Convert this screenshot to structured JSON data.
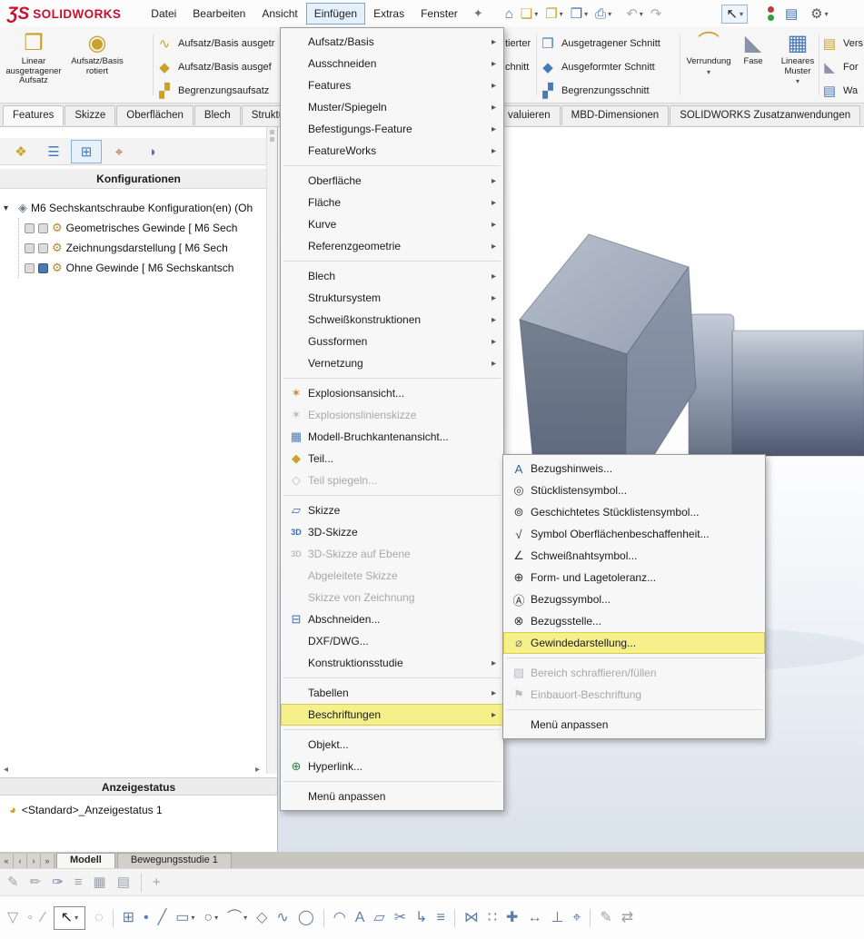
{
  "glyphs": {
    "submenu_arrow": "▸",
    "expander": "▾",
    "root_icon": "◈",
    "config_icon": "⚙",
    "display_state_icon": "◕",
    "scroll_left": "◂",
    "scroll_right": "▸",
    "caret": "▾",
    "cursor": "↖"
  },
  "colors": {
    "brand_red": "#c8102e",
    "highlight_yellow": "#f6f08b",
    "menu_open_blue": "#e4f0fb"
  },
  "menubar": {
    "logo_mark": "ƷS",
    "logo_text": "SOLIDWORKS",
    "pin_glyph": "✦",
    "menus": [
      {
        "label": "Datei"
      },
      {
        "label": "Bearbeiten"
      },
      {
        "label": "Ansicht"
      },
      {
        "label": "Einfügen",
        "open": true
      },
      {
        "label": "Extras"
      },
      {
        "label": "Fenster"
      }
    ],
    "quick_icons": [
      {
        "name": "ds-home-icon",
        "glyph": "⌂",
        "color": "#3b6fb5",
        "gap": 6
      },
      {
        "name": "new-document-icon",
        "glyph": "❏",
        "color": "#c9a227",
        "caret": true
      },
      {
        "name": "open-document-icon",
        "glyph": "❐",
        "color": "#c9a227",
        "caret": true
      },
      {
        "name": "save-icon",
        "glyph": "❒",
        "color": "#3b6fb5",
        "caret": true
      },
      {
        "name": "print-icon",
        "glyph": "⎙",
        "color": "#3b6fb5",
        "caret": true
      },
      {
        "name": "undo-icon",
        "glyph": "↶",
        "color": "#a8adb3",
        "caret": true,
        "gap": 8
      },
      {
        "name": "redo-icon",
        "glyph": "↷",
        "color": "#a8adb3"
      },
      {
        "name": "select-cursor-icon",
        "glyph": "↖",
        "color": "#222222",
        "caret": true,
        "boxed": true,
        "gap": 62
      },
      {
        "name": "status-indicator-icon",
        "dual": [
          "#c23b3b",
          "#2f9e44"
        ],
        "gap": 18
      },
      {
        "name": "task-pane-icon",
        "glyph": "▤",
        "color": "#3b6fb5",
        "gap": 4
      },
      {
        "name": "options-gear-icon",
        "glyph": "⚙",
        "color": "#5a5a5a",
        "caret": true,
        "gap": 6
      }
    ]
  },
  "features_toolbar": {
    "large_left": [
      {
        "label": "Linear\nausgetragener\nAufsatz",
        "icon": {
          "name": "extruded-boss-icon",
          "glyph": "❒",
          "color": "#c9a227"
        }
      },
      {
        "label": "Aufsatz/Basis\nrotiert",
        "icon": {
          "name": "revolved-boss-icon",
          "glyph": "◉",
          "color": "#c9a227"
        }
      }
    ],
    "small_left": [
      {
        "label": "Aufsatz/Basis ausgetr",
        "icon": {
          "name": "swept-boss-icon",
          "glyph": "∿",
          "color": "#c9a227"
        }
      },
      {
        "label": "Aufsatz/Basis ausgef",
        "icon": {
          "name": "lofted-boss-icon",
          "glyph": "◆",
          "color": "#c9a227"
        }
      },
      {
        "label": "Begrenzungsaufsatz",
        "icon": {
          "name": "boundary-boss-icon",
          "glyph": "▞",
          "color": "#c9a227"
        }
      }
    ],
    "hidden_fragments": [
      "tierter",
      "chnitt"
    ],
    "small_right": [
      {
        "label": "Ausgetragener Schnitt",
        "icon": {
          "name": "swept-cut-icon",
          "glyph": "❒",
          "color": "#4a7ab5"
        }
      },
      {
        "label": "Ausgeformter Schnitt",
        "icon": {
          "name": "lofted-cut-icon",
          "glyph": "◆",
          "color": "#4a7ab5"
        }
      },
      {
        "label": "Begrenzungsschnitt",
        "icon": {
          "name": "boundary-cut-icon",
          "glyph": "▞",
          "color": "#4a7ab5"
        }
      }
    ],
    "large_right": [
      {
        "label": "Verrundung",
        "caret": true,
        "icon": {
          "name": "fillet-icon",
          "glyph": "⌒",
          "color": "#c9a227"
        }
      },
      {
        "label": "Fase",
        "narrow": true,
        "icon": {
          "name": "chamfer-icon",
          "glyph": "◣",
          "color": "#8a93a5"
        }
      },
      {
        "label": "Lineares\nMuster",
        "caret": true,
        "icon": {
          "name": "linear-pattern-icon",
          "glyph": "▦",
          "color": "#4a7ab5"
        }
      }
    ],
    "edge_fragments": [
      {
        "label": "Vers",
        "icon": {
          "name": "rib-icon",
          "glyph": "▤",
          "color": "#c9a227"
        }
      },
      {
        "label": "For",
        "icon": {
          "name": "draft-icon",
          "glyph": "◣",
          "color": "#8a93a5"
        }
      },
      {
        "label": "Wa",
        "icon": {
          "name": "shell-icon",
          "glyph": "▤",
          "color": "#4a7ab5"
        }
      }
    ]
  },
  "command_tabs": {
    "left": [
      "Features",
      "Skizze",
      "Oberflächen",
      "Blech",
      "Struktu"
    ],
    "right": [
      "valuieren",
      "MBD-Dimensionen",
      "SOLIDWORKS Zusatzanwendungen"
    ]
  },
  "config_panel": {
    "header": "Konfigurationen",
    "tabs": [
      {
        "name": "featuremanager-tab-icon",
        "glyph": "❖",
        "color": "#c9a227"
      },
      {
        "name": "propertymanager-tab-icon",
        "glyph": "☰",
        "color": "#4a7ab5"
      },
      {
        "name": "configurationmanager-tab-icon",
        "glyph": "⊞",
        "color": "#4a7ab5",
        "active": true
      },
      {
        "name": "dimxpertmanager-tab-icon",
        "glyph": "⌖",
        "color": "#b5583a"
      },
      {
        "name": "displaymanager-tab-icon",
        "glyph": "◑",
        "color": "#8e5ba6"
      }
    ],
    "tree": {
      "root_label": "M6 Sechskantschraube Konfiguration(en)  (Oh",
      "children": [
        {
          "label": "Geometrisches Gewinde [ M6 Sech",
          "marks": [
            "gray",
            "gray"
          ]
        },
        {
          "label": "Zeichnungsdarstellung [ M6 Sech",
          "marks": [
            "gray",
            "gray"
          ]
        },
        {
          "label": "Ohne Gewinde [ M6 Sechskantsch",
          "marks": [
            "gray",
            "blue"
          ]
        }
      ]
    },
    "display_state_header": "Anzeigestatus",
    "display_state_item": "<Standard>_Anzeigestatus 1"
  },
  "insert_menu": {
    "items": [
      {
        "label": "Aufsatz/Basis",
        "sub": true
      },
      {
        "label": "Ausschneiden",
        "sub": true
      },
      {
        "label": "Features",
        "sub": true
      },
      {
        "label": "Muster/Spiegeln",
        "sub": true
      },
      {
        "label": "Befestigungs-Feature",
        "sub": true
      },
      {
        "label": "FeatureWorks",
        "sub": true
      },
      {
        "sep": true
      },
      {
        "label": "Oberfläche",
        "sub": true
      },
      {
        "label": "Fläche",
        "sub": true
      },
      {
        "label": "Kurve",
        "sub": true
      },
      {
        "label": "Referenzgeometrie",
        "sub": true
      },
      {
        "sep": true
      },
      {
        "label": "Blech",
        "sub": true
      },
      {
        "label": "Struktursystem",
        "sub": true
      },
      {
        "label": "Schweißkonstruktionen",
        "sub": true
      },
      {
        "label": "Gussformen",
        "sub": true
      },
      {
        "label": "Vernetzung",
        "sub": true
      },
      {
        "sep": true
      },
      {
        "label": "Explosionsansicht...",
        "icon": {
          "name": "exploded-view-icon",
          "glyph": "✶",
          "color": "#d9822b"
        }
      },
      {
        "label": "Explosionslinienskizze",
        "dis": true,
        "icon": {
          "name": "explode-line-sketch-icon",
          "glyph": "✶",
          "color": "#b9bec4"
        }
      },
      {
        "label": "Modell-Bruchkantenansicht...",
        "icon": {
          "name": "model-break-view-icon",
          "glyph": "▦",
          "color": "#4a7ab5"
        }
      },
      {
        "label": "Teil...",
        "icon": {
          "name": "part-icon",
          "glyph": "◆",
          "color": "#c9a227"
        }
      },
      {
        "label": "Teil spiegeln...",
        "dis": true,
        "icon": {
          "name": "mirror-part-icon",
          "glyph": "◇",
          "color": "#b9bec4"
        }
      },
      {
        "sep": true
      },
      {
        "label": "Skizze",
        "icon": {
          "name": "sketch-icon",
          "glyph": "▱",
          "color": "#3a6db5"
        }
      },
      {
        "label": "3D-Skizze",
        "icon": {
          "name": "sketch3d-icon",
          "glyph": "3D",
          "color": "#3a6db5"
        }
      },
      {
        "label": "3D-Skizze auf Ebene",
        "dis": true,
        "icon": {
          "name": "sketch3d-on-plane-icon",
          "glyph": "3D",
          "color": "#b9bec4"
        }
      },
      {
        "label": "Abgeleitete Skizze",
        "dis": true
      },
      {
        "label": "Skizze von Zeichnung",
        "dis": true
      },
      {
        "label": "Abschneiden...",
        "icon": {
          "name": "slice-icon",
          "glyph": "⊟",
          "color": "#3a6db5"
        }
      },
      {
        "label": "DXF/DWG..."
      },
      {
        "label": "Konstruktionsstudie",
        "sub": true
      },
      {
        "sep": true
      },
      {
        "label": "Tabellen",
        "sub": true
      },
      {
        "label": "Beschriftungen",
        "sub": true,
        "hi": true
      },
      {
        "sep": true
      },
      {
        "label": "Objekt..."
      },
      {
        "label": "Hyperlink...",
        "icon": {
          "name": "hyperlink-icon",
          "glyph": "⊕",
          "color": "#2e7d46"
        }
      },
      {
        "sep": true
      },
      {
        "label": "Menü anpassen"
      }
    ]
  },
  "annotations_submenu": {
    "items": [
      {
        "label": "Bezugshinweis...",
        "icon": {
          "name": "note-icon",
          "glyph": "A",
          "color": "#2f5fa3"
        }
      },
      {
        "label": "Stücklistensymbol...",
        "icon": {
          "name": "balloon-icon",
          "glyph": "◎",
          "color": "#444444"
        }
      },
      {
        "label": "Geschichtetes Stücklistensymbol...",
        "icon": {
          "name": "stacked-balloon-icon",
          "glyph": "⊚",
          "color": "#444444"
        }
      },
      {
        "label": "Symbol Oberflächenbeschaffenheit...",
        "icon": {
          "name": "surface-finish-icon",
          "glyph": "√",
          "color": "#333333"
        }
      },
      {
        "label": "Schweißnahtsymbol...",
        "icon": {
          "name": "weld-symbol-icon",
          "glyph": "∠",
          "color": "#333333"
        }
      },
      {
        "label": "Form- und Lagetoleranz...",
        "icon": {
          "name": "geometric-tolerance-icon",
          "glyph": "⊕",
          "color": "#333333"
        }
      },
      {
        "label": "Bezugssymbol...",
        "icon": {
          "name": "datum-feature-icon",
          "glyph": "Ⓐ",
          "color": "#333333"
        }
      },
      {
        "label": "Bezugsstelle...",
        "icon": {
          "name": "datum-target-icon",
          "glyph": "⊗",
          "color": "#333333"
        }
      },
      {
        "label": "Gewindedarstellung...",
        "hi": true,
        "icon": {
          "name": "cosmetic-thread-icon",
          "glyph": "⌀",
          "color": "#777777"
        }
      },
      {
        "sep": true
      },
      {
        "label": "Bereich schraffieren/füllen",
        "dis": true,
        "icon": {
          "name": "area-hatch-icon",
          "glyph": "▨",
          "color": "#b9bec4"
        }
      },
      {
        "label": "Einbauort-Beschriftung",
        "dis": true,
        "icon": {
          "name": "location-label-icon",
          "glyph": "⚑",
          "color": "#b9bec4"
        }
      },
      {
        "sep": true
      },
      {
        "label": "Menü anpassen"
      }
    ]
  },
  "model_tabs": {
    "nav_icons": [
      {
        "name": "first-tab-icon",
        "glyph": "«"
      },
      {
        "name": "prev-tab-icon",
        "glyph": "‹"
      },
      {
        "name": "next-tab-icon",
        "glyph": "›"
      },
      {
        "name": "last-tab-icon",
        "glyph": "»"
      }
    ],
    "tabs": [
      {
        "label": "Modell",
        "active": true
      },
      {
        "label": "Bewegungsstudie 1"
      }
    ]
  },
  "bottom_toolbar_row1": [
    {
      "name": "annotation-pencil-icon",
      "glyph": "✎",
      "color": "#9aa2ac"
    },
    {
      "name": "note-pencil-icon",
      "glyph": "✏",
      "color": "#9aa2ac"
    },
    {
      "name": "marker-pen-icon",
      "glyph": "✑",
      "color": "#5f7ca6"
    },
    {
      "name": "format-lines-icon",
      "glyph": "≡",
      "color": "#9aa2ac"
    },
    {
      "name": "grid-toggle-icon",
      "glyph": "▦",
      "color": "#9aa2ac"
    },
    {
      "name": "layer-icon",
      "glyph": "▤",
      "color": "#9aa2ac"
    },
    {
      "divider": true
    },
    {
      "name": "pin-toolbar-icon",
      "glyph": "+",
      "color": "#9aa2ac"
    }
  ],
  "bottom_toolbar_row2": [
    {
      "name": "selection-filter-icon",
      "glyph": "▽",
      "color": "#98a0a8"
    },
    {
      "name": "filter-vertices-icon",
      "glyph": "◦",
      "color": "#98a0a8"
    },
    {
      "name": "filter-edges-icon",
      "glyph": "∕",
      "color": "#98a0a8"
    },
    {
      "name": "select-cursor-icon",
      "glyph": "↖",
      "color": "#222222",
      "boxed": true,
      "caret": true
    },
    {
      "name": "lasso-select-icon",
      "glyph": "◌",
      "color": "#98a0a8"
    },
    {
      "divider": true
    },
    {
      "name": "grid-system-icon",
      "glyph": "⊞",
      "color": "#5f7ca6"
    },
    {
      "name": "sketch-point-icon",
      "glyph": "•",
      "color": "#5f7ca6"
    },
    {
      "name": "line-tool-icon",
      "glyph": "╱",
      "color": "#5f7ca6"
    },
    {
      "name": "rectangle-tool-icon",
      "glyph": "▭",
      "color": "#5f7ca6",
      "caret": true
    },
    {
      "name": "circle-tool-icon",
      "glyph": "○",
      "color": "#5f7ca6",
      "caret": true
    },
    {
      "name": "arc-tool-icon",
      "glyph": "⌒",
      "color": "#5f7ca6",
      "caret": true
    },
    {
      "name": "polygon-tool-icon",
      "glyph": "◇",
      "color": "#5f7ca6"
    },
    {
      "name": "spline-tool-icon",
      "glyph": "∿",
      "color": "#5f7ca6"
    },
    {
      "name": "ellipse-tool-icon",
      "glyph": "◯",
      "color": "#5f7ca6"
    },
    {
      "divider": true
    },
    {
      "name": "sketch-fillet-icon",
      "glyph": "◠",
      "color": "#5f7ca6"
    },
    {
      "name": "sketch-text-icon",
      "glyph": "A",
      "color": "#5f7ca6"
    },
    {
      "name": "plane-tool-icon",
      "glyph": "▱",
      "color": "#5f7ca6"
    },
    {
      "name": "trim-entities-icon",
      "glyph": "✂",
      "color": "#5f7ca6"
    },
    {
      "name": "convert-entities-icon",
      "glyph": "↳",
      "color": "#5f7ca6"
    },
    {
      "name": "offset-entities-icon",
      "glyph": "≡",
      "color": "#5f7ca6"
    },
    {
      "divider": true
    },
    {
      "name": "mirror-entities-icon",
      "glyph": "⋈",
      "color": "#5f7ca6"
    },
    {
      "name": "linear-sketch-pattern-icon",
      "glyph": "∷",
      "color": "#5f7ca6"
    },
    {
      "name": "move-entities-icon",
      "glyph": "✚",
      "color": "#5f7ca6"
    },
    {
      "name": "smart-dimension-icon",
      "glyph": "↔",
      "color": "#5f7ca6"
    },
    {
      "name": "add-relation-icon",
      "glyph": "⊥",
      "color": "#5f7ca6"
    },
    {
      "name": "snaps-icon",
      "glyph": "⌖",
      "color": "#5f7ca6"
    },
    {
      "divider": true
    },
    {
      "name": "rapid-sketch-icon",
      "glyph": "✎",
      "color": "#98a0a8"
    },
    {
      "name": "instant2d-icon",
      "glyph": "⇄",
      "color": "#98a0a8"
    }
  ],
  "model": {
    "name": "M6 hex bolt",
    "face_colors": {
      "top": "#a8b1c0",
      "left": "#6b7689",
      "right": "#8893a5"
    }
  }
}
